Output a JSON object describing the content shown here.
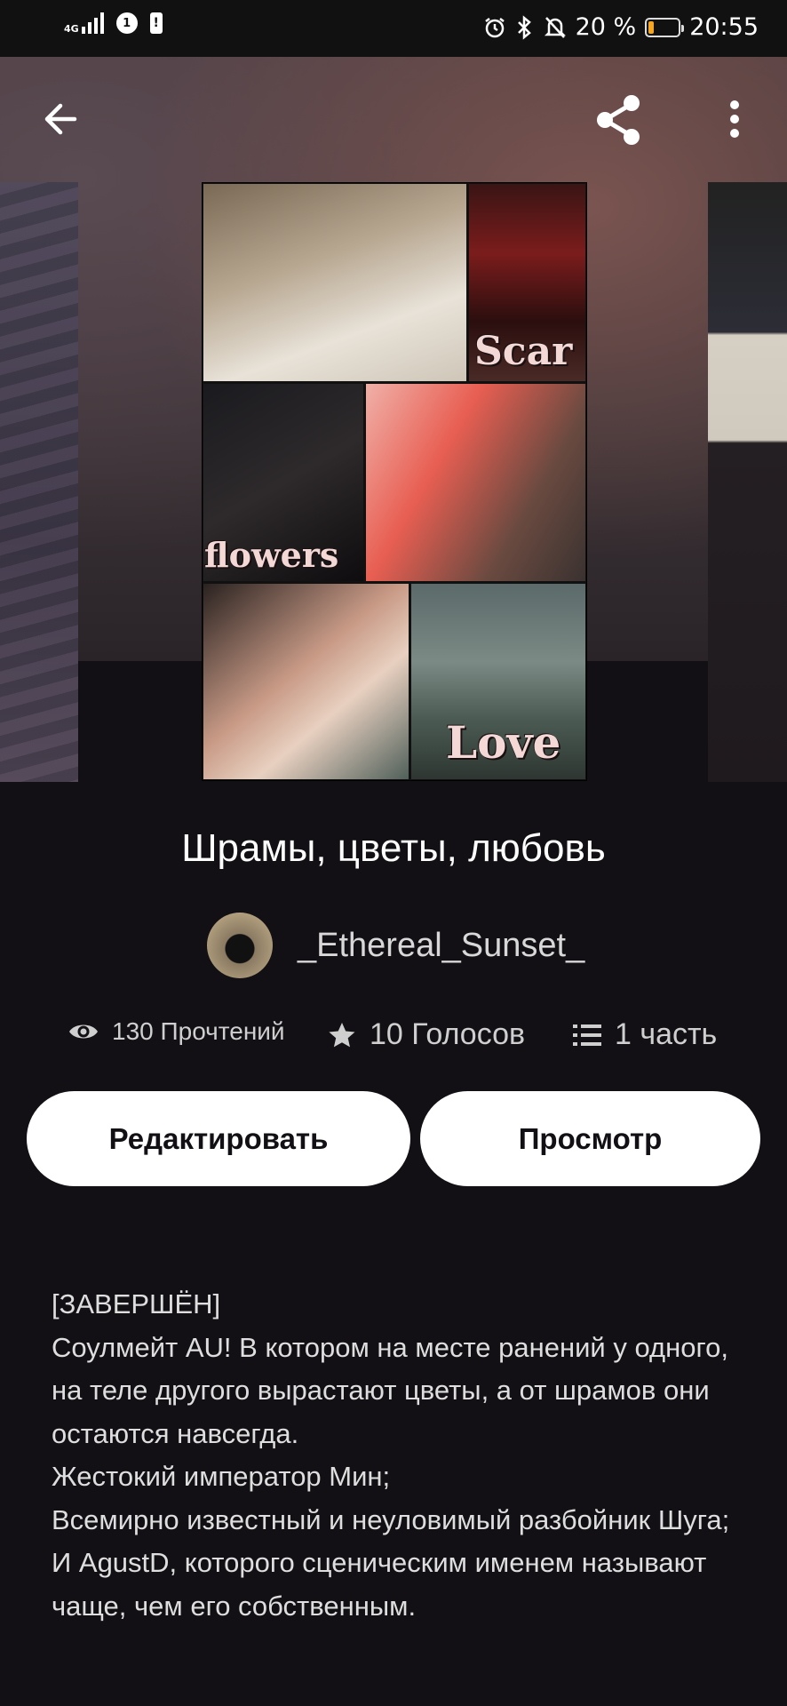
{
  "status_bar": {
    "network": "4G",
    "sim_badge": "1",
    "battery_percent": "20 %",
    "battery_level": 0.2,
    "time": "20:55"
  },
  "topbar": {
    "back_icon": "arrow-left-icon",
    "share_icon": "share-icon",
    "more_icon": "more-vert-icon"
  },
  "cover": {
    "words": [
      "Scar",
      "flowers",
      "Love"
    ]
  },
  "story": {
    "title": "Шрамы, цветы, любовь",
    "author": "_Ethereal_Sunset_",
    "reads": "130 Прочтений",
    "votes": "10 Голосов",
    "parts": "1 часть"
  },
  "actions": {
    "edit_label": "Редактировать",
    "view_label": "Просмотр"
  },
  "description": {
    "lines": [
      "[ЗАВЕРШЁН]",
      "Соулмейт AU! В котором на месте ранений у одного, на теле другого вырастают цветы, а от шрамов они остаются навсегда.",
      "Жестокий император Мин;",
      "Всемирно известный и неуловимый разбойник Шуга;",
      "И AgustD, которого сценическим именем называют чаще, чем его собственным."
    ]
  }
}
